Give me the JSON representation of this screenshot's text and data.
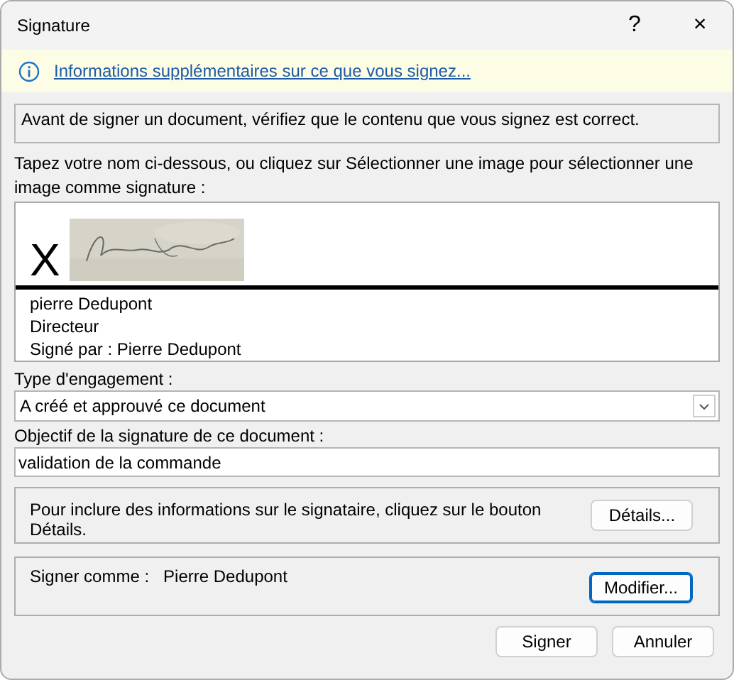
{
  "window": {
    "title": "Signature",
    "help": "?",
    "close": "×"
  },
  "info_bar": {
    "link": "Informations supplémentaires sur ce que vous signez..."
  },
  "notice": "Avant de signer un document, vérifiez que le contenu que vous signez est correct.",
  "instructions": "Tapez votre nom ci-dessous, ou cliquez sur Sélectionner une image pour sélectionner une image comme signature :",
  "signature": {
    "mark": "X",
    "lines": [
      "pierre Dedupont",
      "Directeur",
      "Signé par : Pierre Dedupont"
    ]
  },
  "commitment": {
    "label": "Type d'engagement :",
    "value": "A créé et approuvé ce document"
  },
  "purpose": {
    "label": "Objectif de la signature de ce document :",
    "value": "validation de la commande"
  },
  "details": {
    "text": "Pour inclure des informations sur le signataire, cliquez sur le bouton Détails.",
    "button": {
      "label": "Détails...",
      "focused": false
    }
  },
  "sign_as": {
    "label": "Signer comme :",
    "value": "Pierre Dedupont",
    "button": {
      "label": "Modifier...",
      "focused": true
    }
  },
  "buttons": [
    {
      "label": "Signer",
      "focused": false
    },
    {
      "label": "Annuler",
      "focused": false
    }
  ]
}
